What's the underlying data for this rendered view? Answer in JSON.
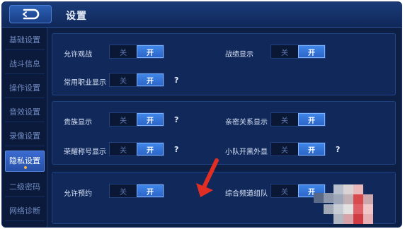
{
  "header": {
    "title": "设置"
  },
  "sidebar": {
    "items": [
      {
        "label": "基础设置"
      },
      {
        "label": "战斗信息"
      },
      {
        "label": "操作设置"
      },
      {
        "label": "音效设置"
      },
      {
        "label": "录像设置"
      },
      {
        "label": "隐私设置",
        "active": true
      },
      {
        "label": "二级密码"
      },
      {
        "label": "网络诊断"
      }
    ]
  },
  "toggle_labels": {
    "off": "关",
    "on": "开"
  },
  "help_mark": "?",
  "settings": {
    "allow_spectate": "允许观战",
    "record_display": "战绩显示",
    "common_role_display": "常用职业显示",
    "noble_display": "贵族显示",
    "intimacy_display": "亲密关系显示",
    "honor_title_display": "荣耀称号显示",
    "team_outside_display": "小队开黑外显",
    "allow_reservation": "允许预约",
    "combined_channel_team": "综合频道组队"
  },
  "colors": {
    "background": "#0d1f45",
    "accent": "#3f86e8",
    "arrow": "#e02e24"
  }
}
